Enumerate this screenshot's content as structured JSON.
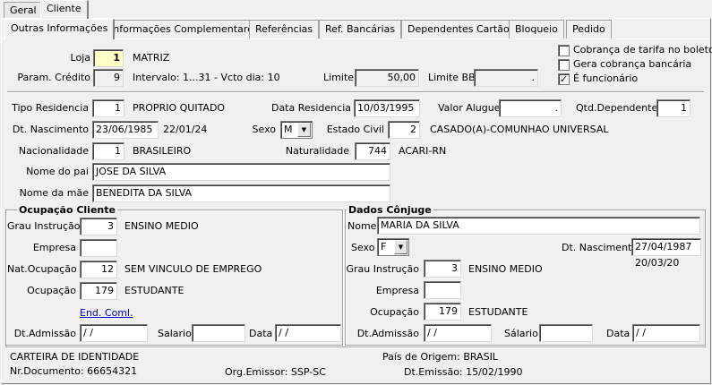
{
  "top_tabs": [
    "Geral",
    "Cliente"
  ],
  "sub_tabs": [
    "Outras Informações",
    "Informações Complementares",
    "Referências",
    "Ref. Bancárias",
    "Dependentes Cartão",
    "Bloqueio",
    "Pedido"
  ],
  "loja": {
    "label": "Loja",
    "value": "1",
    "desc": "MATRIZ"
  },
  "param_credito": {
    "label": "Param. Crédito",
    "value": "9",
    "desc": "Intervalo: 1...31 - Vcto dia: 10"
  },
  "limite": {
    "label": "Limite",
    "value": "50,00"
  },
  "limite_bb": {
    "label": "Limite BB",
    "value": "."
  },
  "checkboxes": [
    {
      "label": "Cobrança de tarifa no boleto",
      "checked": false,
      "mark": ""
    },
    {
      "label": "Gera cobrança bancária",
      "checked": false,
      "mark": ""
    },
    {
      "label": "É funcionário",
      "checked": true,
      "mark": "✓"
    }
  ],
  "tipo_residencia": {
    "label": "Tipo Residencia",
    "value": "1",
    "desc": "PROPRIO QUITADO"
  },
  "data_residencia": {
    "label": "Data Residencia",
    "value": "10/03/1995"
  },
  "valor_aluguel": {
    "label": "Valor Aluguel",
    "value": "."
  },
  "qtd_dependentes": {
    "label": "Qtd.Dependentes",
    "value": "1"
  },
  "dt_nascimento": {
    "label": "Dt. Nascimento",
    "value": "23/06/1985",
    "extra": "22/01/24"
  },
  "sexo": {
    "label": "Sexo",
    "value": "M"
  },
  "estado_civil": {
    "label": "Estado Civil",
    "value": "2",
    "desc": "CASADO(A)-COMUNHAO UNIVERSAL"
  },
  "nacionalidade": {
    "label": "Nacionalidade",
    "value": "1",
    "desc": "BRASILEIRO"
  },
  "naturalidade": {
    "label": "Naturalidade",
    "value": "744",
    "desc": "ACARI-RN"
  },
  "nome_pai": {
    "label": "Nome do pai",
    "value": "JOSE DA SILVA"
  },
  "nome_mae": {
    "label": "Nome da mãe",
    "value": "BENEDITA DA SILVA"
  },
  "ocupacao_cliente": {
    "title": "Ocupação Cliente",
    "grau_instrucao": {
      "label": "Grau Instrução",
      "value": "3",
      "desc": "ENSINO MEDIO"
    },
    "empresa": {
      "label": "Empresa",
      "value": ""
    },
    "nat_ocupacao": {
      "label": "Nat.Ocupação",
      "value": "12",
      "desc": "SEM VINCULO DE EMPREGO"
    },
    "ocupacao": {
      "label": "Ocupação",
      "value": "179",
      "desc": "ESTUDANTE"
    },
    "end_coml": "End. Coml.",
    "dt_admissao": {
      "label": "Dt.Admissão",
      "value": " / /"
    },
    "salario": {
      "label": "Salario",
      "value": ""
    },
    "data": {
      "label": "Data",
      "value": " / /"
    }
  },
  "dados_conjuge": {
    "title": "Dados Cônjuge",
    "nome": {
      "label": "Nome",
      "value": "MARIA DA SILVA"
    },
    "sexo": {
      "label": "Sexo",
      "value": "F"
    },
    "dt_nascimento": {
      "label": "Dt. Nascimento",
      "value": "27/04/1987",
      "extra": "20/03/20"
    },
    "grau_instrucao": {
      "label": "Grau Instrução",
      "value": "3",
      "desc": "ENSINO MEDIO"
    },
    "empresa": {
      "label": "Empresa",
      "value": ""
    },
    "ocupacao": {
      "label": "Ocupação",
      "value": "179",
      "desc": "ESTUDANTE"
    },
    "dt_admissao": {
      "label": "Dt.Admissão",
      "value": " / /"
    },
    "salario": {
      "label": "Sálario",
      "value": ""
    },
    "data": {
      "label": "Data",
      "value": " / /"
    }
  },
  "documento": {
    "tipo": "CARTEIRA DE IDENTIDADE",
    "pais_origem": "País de Origem: BRASIL",
    "nr_documento": "Nr.Documento: 66654321",
    "org_emissor": "Org.Emissor: SSP-SC",
    "dt_emissao": "Dt.Emissão: 15/02/1990"
  }
}
